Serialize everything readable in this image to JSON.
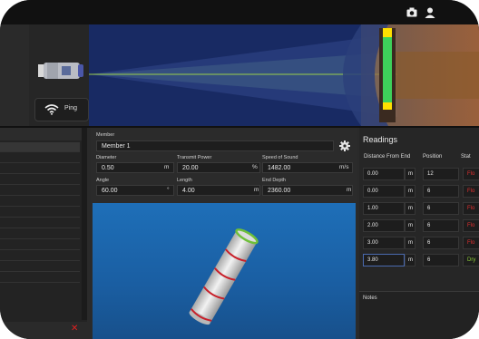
{
  "topbar": {
    "icons": [
      "camera-icon",
      "user-icon"
    ]
  },
  "device": {
    "ping_label": "Ping",
    "icon": "wifi-icon"
  },
  "member": {
    "label": "Member",
    "value": "Member 1",
    "settings_icon": "gear-icon"
  },
  "fields": {
    "diameter": {
      "label": "Diameter",
      "value": "0.50",
      "unit": "m"
    },
    "transmit_power": {
      "label": "Transmit Power",
      "value": "20.00",
      "unit": "%"
    },
    "speed_of_sound": {
      "label": "Speed of Sound",
      "value": "1482.00",
      "unit": "m/s"
    },
    "angle": {
      "label": "Angle",
      "value": "60.00",
      "unit": "°"
    },
    "length": {
      "label": "Length",
      "value": "4.00",
      "unit": "m"
    },
    "end_depth": {
      "label": "End Depth",
      "value": "2360.00",
      "unit": "m"
    }
  },
  "readings": {
    "title": "Readings",
    "columns": [
      "Distance From End",
      "Position",
      "Stat"
    ],
    "rows": [
      {
        "distance": "0.00",
        "unit": "m",
        "position": "12",
        "status": "Flo"
      },
      {
        "distance": "0.00",
        "unit": "m",
        "position": "6",
        "status": "Flo"
      },
      {
        "distance": "1.00",
        "unit": "m",
        "position": "6",
        "status": "Flo"
      },
      {
        "distance": "2.00",
        "unit": "m",
        "position": "6",
        "status": "Flo"
      },
      {
        "distance": "3.00",
        "unit": "m",
        "position": "6",
        "status": "Flo"
      },
      {
        "distance": "3.80",
        "unit": "m",
        "position": "6",
        "status": "Dry"
      }
    ],
    "status_colors": {
      "flood": "#e03030",
      "dry": "#8fcf3a"
    },
    "notes_label": "Notes"
  },
  "list": {
    "delete_icon": "close-icon"
  },
  "colors": {
    "sonar_bg": "#1a2c66",
    "accent_green": "#3ed15a",
    "accent_yellow": "#ffe000"
  }
}
